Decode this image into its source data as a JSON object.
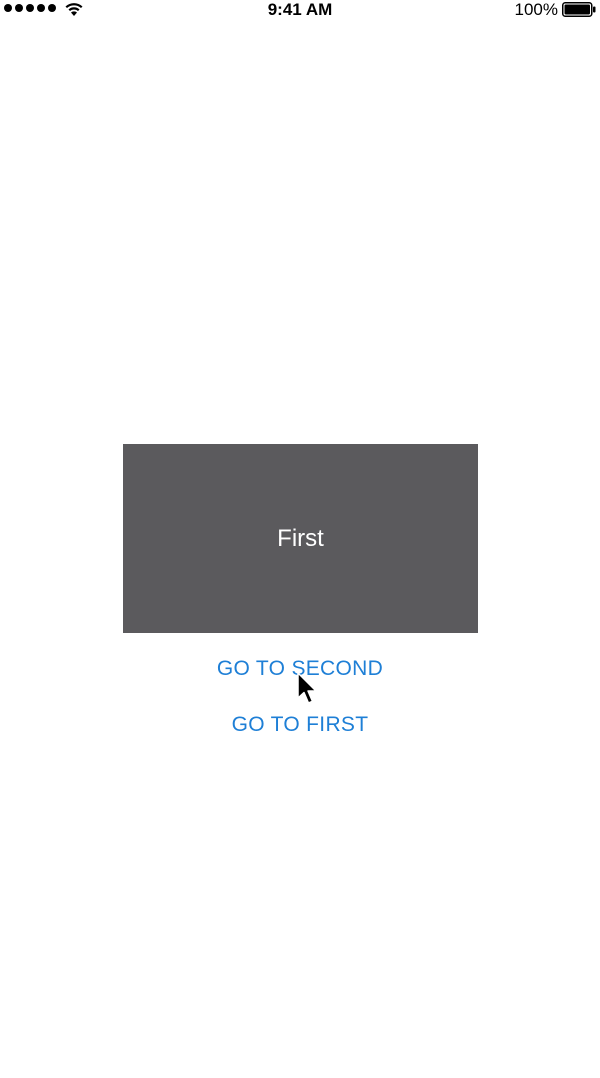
{
  "status_bar": {
    "time": "9:41 AM",
    "battery_percent": "100%",
    "signal_icon": "signal-dots-icon",
    "wifi_icon": "wifi-icon",
    "battery_icon": "battery-full-icon"
  },
  "card": {
    "label": "First",
    "color": "#5b5a5d"
  },
  "buttons": {
    "go_to_second": "GO TO SECOND",
    "go_to_first": "GO TO FIRST",
    "color": "#1e7fd6"
  },
  "cursor_icon": "mouse-pointer-icon"
}
